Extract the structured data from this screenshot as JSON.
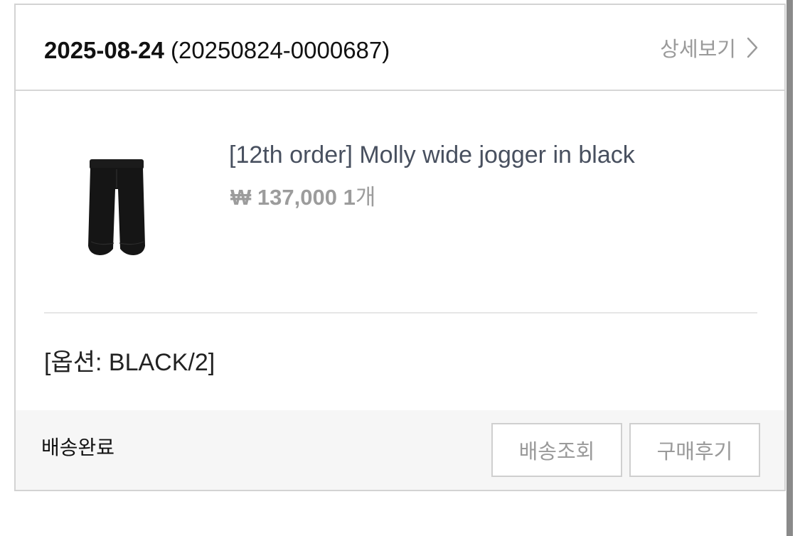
{
  "order": {
    "date": "2025-08-24",
    "number": "(20250824-0000687)",
    "detail_label": "상세보기"
  },
  "product": {
    "name": "[12th order] Molly wide jogger in black",
    "currency": "₩",
    "price": "137,000",
    "quantity": "1",
    "quantity_unit": "개",
    "image_icon": "black-jogger-pants-image"
  },
  "option": {
    "open_bracket": "[",
    "label": "옵션",
    "value": ": BLACK/2]"
  },
  "footer": {
    "status": "배송완료",
    "track_label": "배송조회",
    "review_label": "구매후기"
  }
}
